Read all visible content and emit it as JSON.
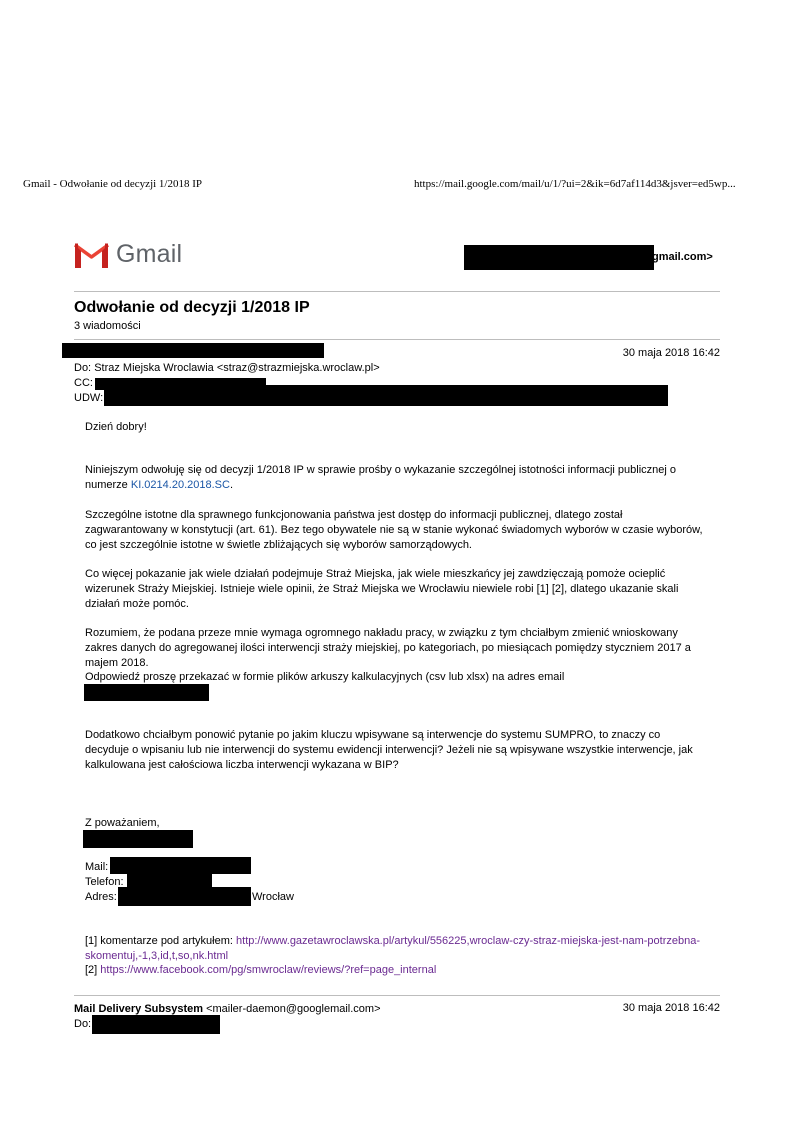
{
  "print_header": {
    "title": "Gmail - Odwołanie od decyzji 1/2018 IP",
    "url": "https://mail.google.com/mail/u/1/?ui=2&ik=6d7af114d3&jsver=ed5wp..."
  },
  "brand": {
    "name": "Gmail",
    "colors": {
      "red": "#c5221f",
      "lightred": "#ea4335",
      "gray": "#5f6368"
    }
  },
  "account": {
    "email_suffix": "gmail.com>"
  },
  "thread": {
    "subject": "Odwołanie od decyzji 1/2018 IP",
    "count": "3 wiadomości"
  },
  "message1": {
    "date": "30 maja 2018 16:42",
    "to_label": "Do:",
    "to": "Straz Miejska Wroclawia <straz@strazmiejska.wroclaw.pl>",
    "cc_label": "CC:",
    "bcc_label": "UDW:",
    "greeting": "Dzień dobry!",
    "p1_text": "Niniejszym odwołuję się od decyzji 1/2018 IP w sprawie prośby o wykazanie szczególnej istotności informacji publicznej o numerze ",
    "p1_link": "KI.0214.20.2018.SC",
    "p1_end": ".",
    "p2": "Szczególne istotne dla sprawnego funkcjonowania państwa jest dostęp do informacji publicznej, dlatego został zagwarantowany w konstytucji (art. 61). Bez tego obywatele nie są  w stanie wykonać świadomych wyborów w czasie wyborów, co jest szczególnie istotne w świetle zbliżających się wyborów samorządowych.",
    "p3": "Co więcej pokazanie jak wiele działań podejmuje Straż Miejska, jak wiele mieszkańcy jej zawdzięczają pomoże ocieplić wizerunek Straży Miejskiej. Istnieje wiele opinii, że Straż Miejska we Wrocławiu niewiele robi [1] [2], dlatego ukazanie skali działań może pomóc.",
    "p4": "Rozumiem, że podana przeze mnie wymaga ogromnego nakładu pracy, w związku z tym chciałbym zmienić wnioskowany zakres danych do agregowanej ilości interwencji straży miejskiej, po kategoriach, po miesiącach pomiędzy styczniem 2017 a majem 2018.",
    "p5": "Odpowiedź proszę przekazać w formie plików arkuszy kalkulacyjnych (csv lub xlsx) na adres email",
    "p6": "Dodatkowo chciałbym ponowić pytanie po jakim kluczu wpisywane są interwencje do systemu SUMPRO, to znaczy co decyduje o wpisaniu lub nie interwencji do systemu ewidencji interwencji? Jeżeli nie są wpisywane wszystkie interwencje, jak kalkulowana jest całościowa liczba interwencji wykazana w BIP?",
    "closing": "Z poważaniem,",
    "mail_label": "Mail:",
    "phone_label": "Telefon:",
    "address_label": "Adres:",
    "address_city": "Wrocław",
    "ref1_text": "[1] komentarze pod artykułem: ",
    "ref1_url": "http://www.gazetawroclawska.pl/artykul/556225,wroclaw-czy-straz-miejska-jest-nam-potrzebna-skomentuj,-1,3,id,t,so,nk.html",
    "ref2_text": "[2] ",
    "ref2_url": "https://www.facebook.com/pg/smwroclaw/reviews/?ref=page_internal"
  },
  "message2": {
    "sender_name": "Mail Delivery Subsystem",
    "sender_email": "<mailer-daemon@googlemail.com>",
    "date": "30 maja 2018 16:42",
    "to_label": "Do:"
  }
}
